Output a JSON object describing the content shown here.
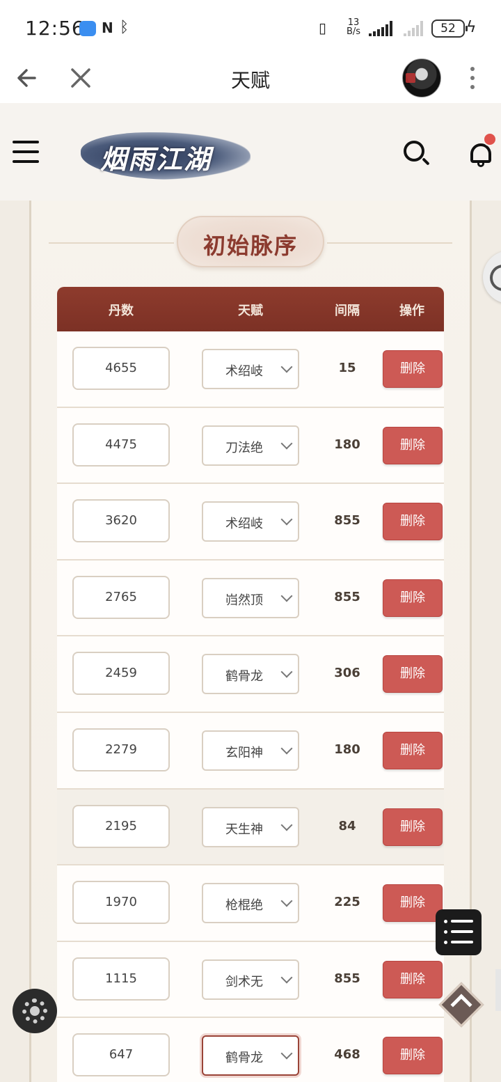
{
  "status_bar": {
    "time": "12:56",
    "net_speed_value": "13",
    "net_speed_unit": "B/s",
    "battery": "52"
  },
  "browser": {
    "title": "天赋",
    "back_icon": "arrow-left-icon",
    "close_icon": "close-icon",
    "more_icon": "more-vertical-icon"
  },
  "site": {
    "logo_text": "烟雨江湖",
    "menu_icon": "hamburger-icon",
    "search_icon": "search-icon",
    "bell_icon": "bell-icon",
    "accent_color": "#8e3b2d",
    "danger_color": "#cd5a55"
  },
  "section": {
    "title": "初始脉序"
  },
  "table": {
    "headers": {
      "dan": "丹数",
      "talent": "天赋",
      "interval": "间隔",
      "action": "操作"
    },
    "rows": [
      {
        "dan": "4655",
        "talent": "术绍岐",
        "interval": "15",
        "action": "删除"
      },
      {
        "dan": "4475",
        "talent": "刀法绝",
        "interval": "180",
        "action": "删除"
      },
      {
        "dan": "3620",
        "talent": "术绍岐",
        "interval": "855",
        "action": "删除"
      },
      {
        "dan": "2765",
        "talent": "岿然顶",
        "interval": "855",
        "action": "删除"
      },
      {
        "dan": "2459",
        "talent": "鹤骨龙",
        "interval": "306",
        "action": "删除"
      },
      {
        "dan": "2279",
        "talent": "玄阳神",
        "interval": "180",
        "action": "删除"
      },
      {
        "dan": "2195",
        "talent": "天生神",
        "interval": "84",
        "action": "删除"
      },
      {
        "dan": "1970",
        "talent": "枪棍绝",
        "interval": "225",
        "action": "删除"
      },
      {
        "dan": "1115",
        "talent": "剑术无",
        "interval": "855",
        "action": "删除"
      },
      {
        "dan": "647",
        "talent": "鹤骨龙",
        "interval": "468",
        "action": "删除"
      }
    ]
  }
}
